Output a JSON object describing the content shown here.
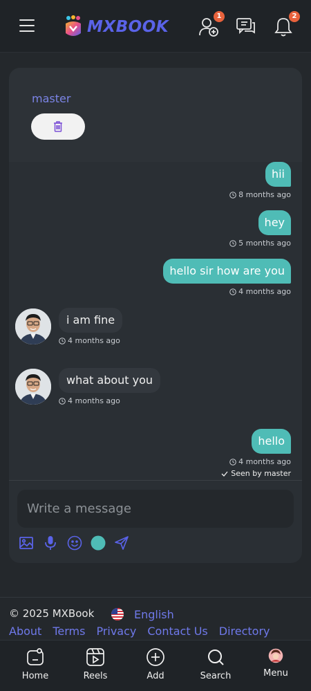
{
  "header": {
    "logo_text": "MXBOOK",
    "friend_requests_badge": "1",
    "notifications_badge": "2"
  },
  "chat": {
    "contact_name": "master",
    "messages": [
      {
        "direction": "out",
        "text": "hii",
        "time": "8 months ago"
      },
      {
        "direction": "out",
        "text": "hey",
        "time": "5 months ago"
      },
      {
        "direction": "out",
        "text": "hello sir how are you",
        "time": "4 months ago"
      },
      {
        "direction": "in",
        "text": "i am fine",
        "time": "4 months ago"
      },
      {
        "direction": "in",
        "text": "what about you",
        "time": "4 months ago"
      },
      {
        "direction": "out",
        "text": "hello",
        "time": "4 months ago"
      }
    ],
    "seen_text": "Seen by master",
    "input_placeholder": "Write a message"
  },
  "footer": {
    "copyright": "© 2025 MXBook",
    "language": "English",
    "links": [
      "About",
      "Terms",
      "Privacy",
      "Contact Us",
      "Directory"
    ]
  },
  "bottom_nav": {
    "items": [
      {
        "label": "Home",
        "icon": "home-icon"
      },
      {
        "label": "Reels",
        "icon": "reels-icon"
      },
      {
        "label": "Add",
        "icon": "add-icon"
      },
      {
        "label": "Search",
        "icon": "search-icon"
      },
      {
        "label": "Menu",
        "icon": "avatar-menu-icon"
      }
    ]
  },
  "colors": {
    "background": "#24282c",
    "accent": "#5a63e8",
    "bubble_out": "#4fbcb6",
    "bubble_in": "#33383e",
    "badge": "#e8623c"
  }
}
